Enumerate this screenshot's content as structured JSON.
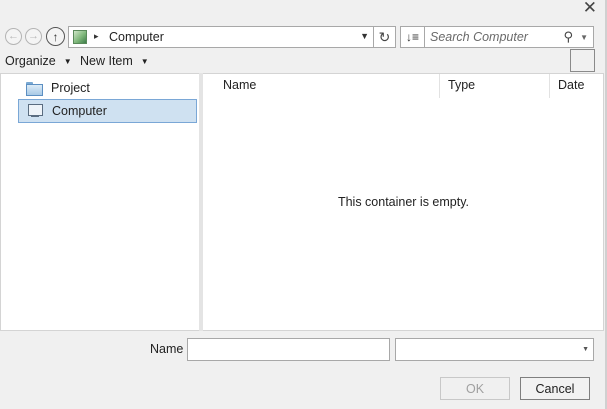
{
  "window": {
    "close_glyph": "✕"
  },
  "nav": {
    "back_icon": "back-arrow-icon",
    "forward_icon": "forward-arrow-icon",
    "up_icon": "up-arrow-icon"
  },
  "address": {
    "location": "Computer",
    "separator": "▸",
    "dropdown_glyph": "▼"
  },
  "refresh_glyph": "↻",
  "sort_glyph": "↓≡",
  "search": {
    "placeholder": "Search Computer",
    "icon_glyph": "⚲",
    "dropdown_glyph": "▼"
  },
  "toolbar": {
    "organize_label": "Organize",
    "new_item_label": "New Item",
    "caret": "▼"
  },
  "tree": {
    "items": [
      {
        "label": "Project",
        "icon": "folder-icon",
        "selected": false
      },
      {
        "label": "Computer",
        "icon": "computer-icon",
        "selected": true
      }
    ]
  },
  "columns": [
    "Name",
    "Type",
    "Date"
  ],
  "content": {
    "empty_message": "This container is empty."
  },
  "footer": {
    "name_label": "Name",
    "name_value": "",
    "type_value": "",
    "type_dropdown_glyph": "▼",
    "ok_label": "OK",
    "cancel_label": "Cancel"
  },
  "colors": {
    "selection_bg": "#cfe1f1",
    "selection_border": "#7aa7d6"
  }
}
